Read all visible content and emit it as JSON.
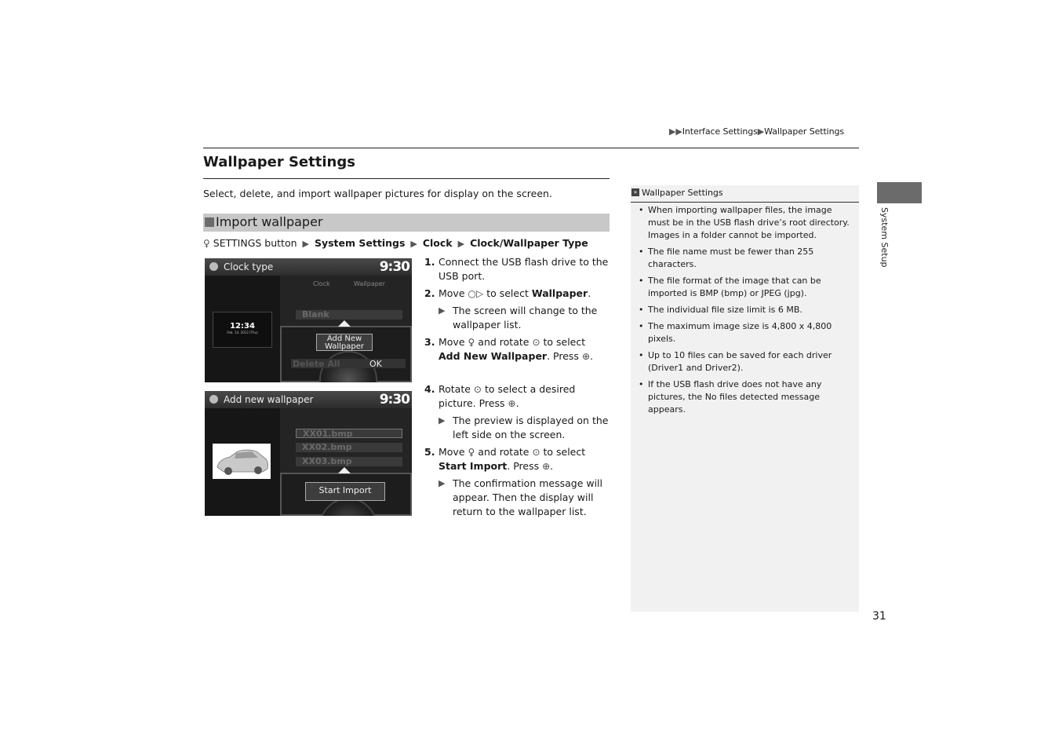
{
  "breadcrumb": {
    "prefix": "▶▶",
    "items": [
      "Interface Settings",
      "Wallpaper Settings"
    ],
    "separator": "▶"
  },
  "page": {
    "title": "Wallpaper Settings",
    "intro": "Select, delete, and import wallpaper pictures for display on the screen.",
    "number": "31",
    "side_tab": "System Setup"
  },
  "section": {
    "title": "Import wallpaper",
    "path": {
      "icon": "settings-button-icon",
      "start": "SETTINGS button",
      "separator": "▶",
      "items": [
        "System Settings",
        "Clock",
        "Clock/Wallpaper Type"
      ]
    }
  },
  "screen1": {
    "title": "Clock type",
    "time": "9:30",
    "tabs": [
      "Clock",
      "Wallpaper"
    ],
    "preview_time": "12:34",
    "preview_date": "Feb. 14, 2012 (Thu)",
    "list_item": "Blank",
    "popup_button": "Add New Wallpaper",
    "delete_label": "Delete All",
    "ok_label": "OK"
  },
  "screen2": {
    "title": "Add new wallpaper",
    "time": "9:30",
    "files": [
      "XX01.bmp",
      "XX02.bmp",
      "XX03.bmp"
    ],
    "popup_button": "Start Import"
  },
  "steps": [
    {
      "num": "1.",
      "text": "Connect the USB flash drive to the USB port."
    },
    {
      "num": "2.",
      "pre": "Move",
      "icon": "○▷",
      "mid": "to select",
      "bold": "Wallpaper",
      "post": ".",
      "result": "The screen will change to the wallpaper list."
    },
    {
      "num": "3.",
      "pre": "Move",
      "icon1": "♀",
      "mid1": "and rotate",
      "icon2": "⊙",
      "mid2": "to select",
      "bold": "Add New Wallpaper",
      "post": ". Press",
      "icon3": "⊕",
      "end": "."
    },
    {
      "num": "4.",
      "pre": "Rotate",
      "icon": "⊙",
      "mid": "to select a desired picture. Press",
      "icon2": "⊕",
      "end": ".",
      "result": "The preview is displayed on the left side on the screen."
    },
    {
      "num": "5.",
      "pre": "Move",
      "icon1": "♀",
      "mid1": "and rotate",
      "icon2": "⊙",
      "mid2": "to select",
      "bold": "Start Import",
      "post": ". Press",
      "icon3": "⊕",
      "end": ".",
      "result": "The confirmation message will appear. Then the display will return to the wallpaper list."
    }
  ],
  "result_arrow": "▶",
  "notes": {
    "icon": "»",
    "title": "Wallpaper Settings",
    "items": [
      "When importing wallpaper files, the image must be in the USB flash drive’s root directory. Images in a folder cannot be imported.",
      "The file name must be fewer than 255 characters.",
      "The file format of the image that can be imported is BMP (bmp) or JPEG (jpg).",
      "The individual file size limit is 6 MB.",
      "The maximum image size is 4,800 x 4,800 pixels.",
      "Up to 10 files can be saved for each driver (Driver1 and Driver2).",
      "If the USB flash drive does not have any pictures, the No files detected message appears."
    ]
  }
}
